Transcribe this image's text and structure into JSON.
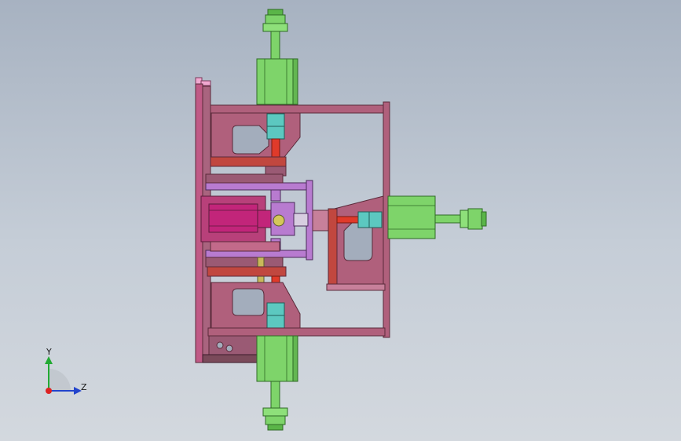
{
  "axis_triad": {
    "y_label": "Y",
    "z_label": "Z",
    "y_color": "#22aa33",
    "z_color": "#2244cc",
    "origin_color": "#dd2222"
  },
  "colors": {
    "frame": "#b0607c",
    "frame_edge": "#5a2a3a",
    "cylinder": "#7ed46a",
    "cylinder_edge": "#2f6a25",
    "rod_red": "#e03a2a",
    "connector_cyan": "#5cc8c0",
    "magenta": "#c2257a",
    "violet": "#b87bd0",
    "pink_bracket": "#c7809a",
    "plate": "#9a5a74",
    "olive": "#c9b85a",
    "yellow_disc": "#d4c75a"
  }
}
